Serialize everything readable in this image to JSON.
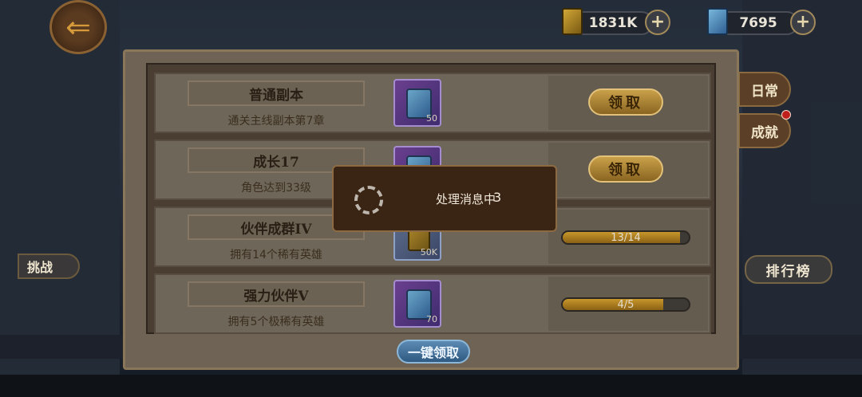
{
  "currencies": {
    "gold": {
      "value": "1831K",
      "plus": "+"
    },
    "gems": {
      "value": "7695",
      "plus": "+"
    }
  },
  "side_tabs": [
    {
      "label": "日常"
    },
    {
      "label": "成就"
    }
  ],
  "side_buttons": {
    "challenge": "挑战",
    "ranking": "排行榜"
  },
  "tasks": [
    {
      "title": "普通副本",
      "description": "通关主线副本第7章",
      "reward_icon": "gem-icon",
      "reward_count": "50",
      "action": "领取"
    },
    {
      "title": "成长17",
      "description": "角色达到33级",
      "reward_icon": "gem-icon",
      "reward_count": "",
      "action": "领取"
    },
    {
      "title": "伙伴成群IV",
      "description": "拥有14个稀有英雄",
      "reward_icon": "gold-icon",
      "reward_count": "50K",
      "progress_text": "13/14",
      "progress": 0.93
    },
    {
      "title": "强力伙伴V",
      "description": "拥有5个极稀有英雄",
      "reward_icon": "gem-icon",
      "reward_count": "70",
      "progress_text": "4/5",
      "progress": 0.8
    }
  ],
  "claim_all_label": "一键领取",
  "toast": {
    "text": "处理消息中",
    "count": "3"
  },
  "colors": {
    "gold": "#c8962a",
    "panel": "#6e6355",
    "claim": "#c9a049",
    "claim_all": "#3f6f9a"
  }
}
